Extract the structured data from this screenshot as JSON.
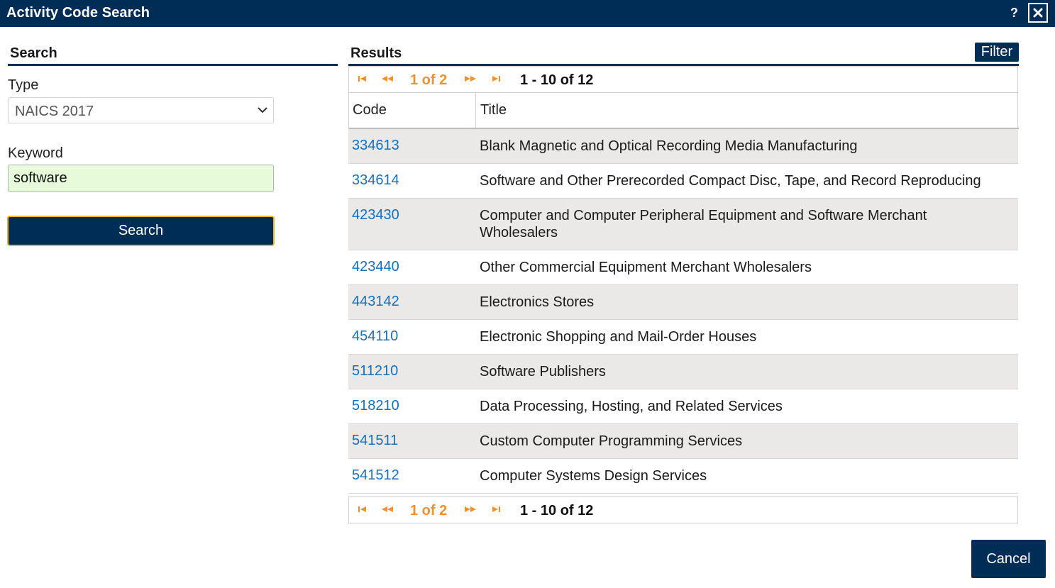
{
  "window": {
    "title": "Activity Code Search",
    "help_label": "?",
    "close_icon": "close-icon"
  },
  "search_panel": {
    "heading": "Search",
    "type_label": "Type",
    "type_value": "NAICS 2017",
    "keyword_label": "Keyword",
    "keyword_value": "software",
    "search_button": "Search"
  },
  "results_panel": {
    "heading": "Results",
    "filter_button": "Filter",
    "pager": {
      "page_text": "1 of 2",
      "range_text": "1 - 10 of 12"
    },
    "columns": [
      "Code",
      "Title"
    ],
    "rows": [
      {
        "code": "334613",
        "title": "Blank Magnetic and Optical Recording Media Manufacturing"
      },
      {
        "code": "334614",
        "title": "Software and Other Prerecorded Compact Disc, Tape, and Record Reproducing"
      },
      {
        "code": "423430",
        "title": "Computer and Computer Peripheral Equipment and Software Merchant Wholesalers"
      },
      {
        "code": "423440",
        "title": "Other Commercial Equipment Merchant Wholesalers"
      },
      {
        "code": "443142",
        "title": "Electronics Stores"
      },
      {
        "code": "454110",
        "title": "Electronic Shopping and Mail-Order Houses"
      },
      {
        "code": "511210",
        "title": "Software Publishers"
      },
      {
        "code": "518210",
        "title": "Data Processing, Hosting, and Related Services"
      },
      {
        "code": "541511",
        "title": "Custom Computer Programming Services"
      },
      {
        "code": "541512",
        "title": "Computer Systems Design Services"
      }
    ]
  },
  "footer": {
    "cancel_button": "Cancel"
  },
  "colors": {
    "brand_navy": "#002d56",
    "pager_orange": "#f0922b",
    "link_blue": "#1a6fb5",
    "keyword_bg": "#e7fad9",
    "focus_outline": "#f0b429"
  }
}
